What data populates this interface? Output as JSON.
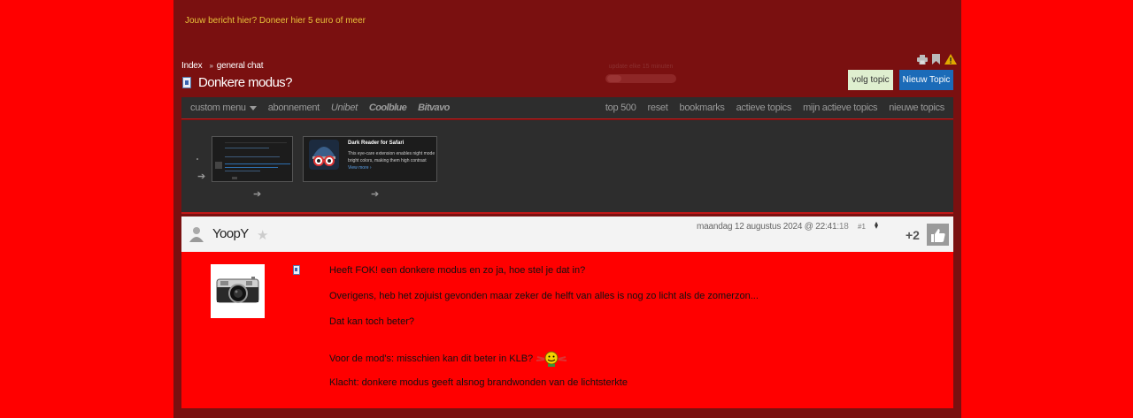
{
  "ad": {
    "text": "Jouw bericht hier? Doneer hier 5 euro of meer"
  },
  "breadcrumb": {
    "index": "Index",
    "sep": "»",
    "forum": "general chat"
  },
  "topic": {
    "title": "Donkere modus?"
  },
  "update": {
    "label": "update elke 15 minuten"
  },
  "buttons": {
    "follow": "volg topic",
    "new_topic": "Nieuw Topic"
  },
  "nav": {
    "left": [
      {
        "label": "custom menu",
        "style": "plain",
        "dropdown": true
      },
      {
        "label": "abonnement",
        "style": "plain"
      },
      {
        "label": "Unibet",
        "style": "italic"
      },
      {
        "label": "Coolblue",
        "style": "bold"
      },
      {
        "label": "Bitvavo",
        "style": "bold"
      }
    ],
    "right": [
      "top 500",
      "reset",
      "bookmarks",
      "actieve topics",
      "mijn actieve topics",
      "nieuwe topics"
    ]
  },
  "featured": {
    "thumb2": {
      "title": "Dark Reader for Safari",
      "desc1": "This eye-care extension enables night mode",
      "desc2": "bright colors, making them high contrast",
      "more": "View more ›"
    }
  },
  "post": {
    "user": "YoopY",
    "date": "maandag 12 augustus 2024 @ 22:41",
    "seconds": ":18",
    "number": "#1",
    "score": "+2",
    "lines": [
      "Heeft FOK! een donkere modus en zo ja, hoe stel je dat in?",
      "Overigens, heb het zojuist gevonden maar zeker de helft van alles is nog zo licht als de zomerzon...",
      "Dat kan toch beter?",
      "Voor de mod's: misschien kan dit beter in KLB?",
      "Klacht: donkere modus geeft alsnog brandwonden van de lichtsterkte"
    ]
  },
  "colors": {
    "page_bg": "#ff0000",
    "frame": "#7a1010",
    "navbar": "#2d2d2d",
    "accent_blue": "#1b6bb8",
    "follow_bg": "#dfefcf"
  }
}
